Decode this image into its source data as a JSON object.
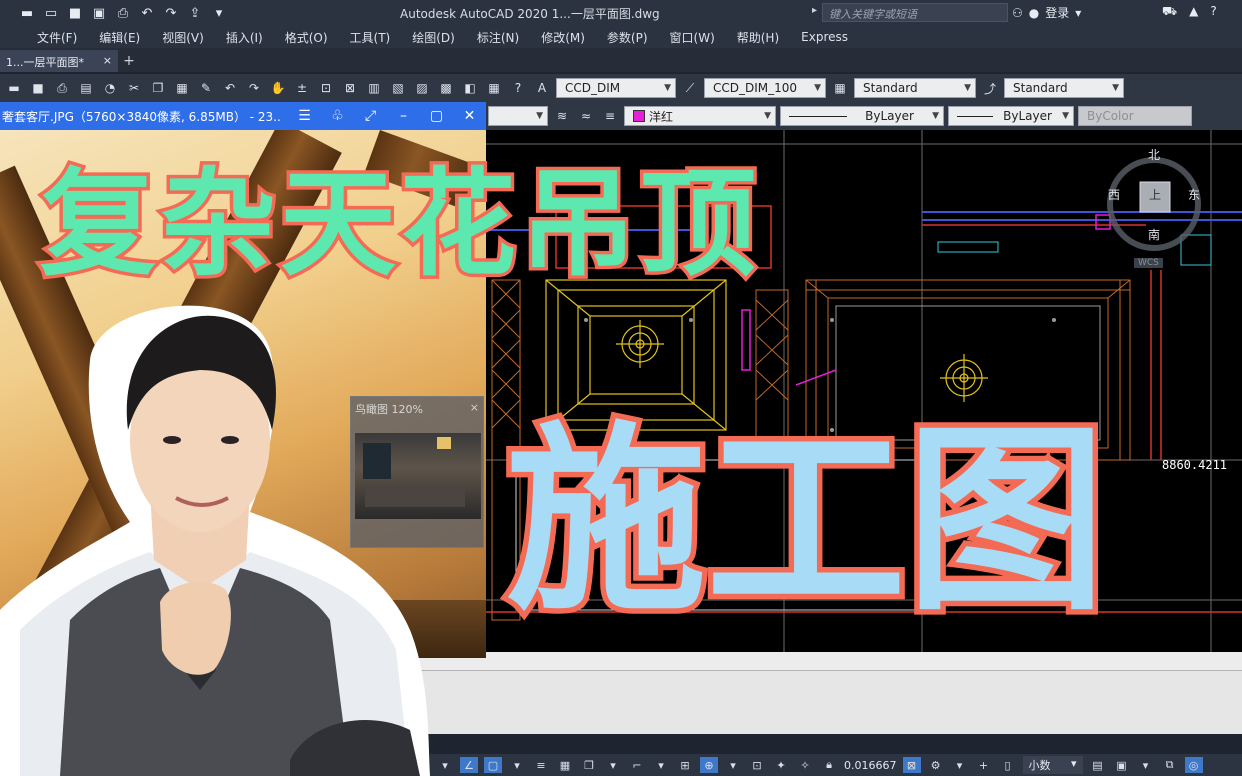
{
  "titlebar": {
    "app_title": "Autodesk AutoCAD 2020    1...一层平面图.dwg",
    "search_placeholder": "键入关键字或短语",
    "login_label": "登录",
    "icons": [
      "new-icon",
      "open-icon",
      "save-icon",
      "saveas-icon",
      "print-icon",
      "undo-icon",
      "redo-icon",
      "share-icon"
    ]
  },
  "menu": {
    "items": [
      "文件(F)",
      "编辑(E)",
      "视图(V)",
      "插入(I)",
      "格式(O)",
      "工具(T)",
      "绘图(D)",
      "标注(N)",
      "修改(M)",
      "参数(P)",
      "窗口(W)",
      "帮助(H)",
      "Express"
    ]
  },
  "tabs": {
    "file_tab": "1...一层平面图*",
    "close": "×",
    "plus": "+"
  },
  "toolbar1": {
    "text_style": "CCD_DIM",
    "dim_style": "CCD_DIM_100",
    "table_style": "Standard",
    "multileader_style": "Standard"
  },
  "toolbar2": {
    "layer_color_name": "洋红",
    "layer_color": "#e61ed8",
    "linetype": "ByLayer",
    "lineweight": "ByLayer",
    "plot_style": "ByColor"
  },
  "viewer": {
    "title": "奢套客厅.JPG（5760×3840像素, 6.85MB） - 23...",
    "navigator_title": "鸟瞰图 120%",
    "navigator_close": "×"
  },
  "viewcube": {
    "north": "北",
    "south": "南",
    "east": "东",
    "west": "西",
    "top": "上",
    "wcs": "WCS"
  },
  "canvas": {
    "coord_readout": "8860.4211"
  },
  "statusbar": {
    "scale": "0.016667",
    "units": "小数"
  },
  "overlay": {
    "headline": "复杂天花吊顶",
    "subline": "施工图"
  },
  "colors": {
    "headline_fill": "#5de8b0",
    "subline_fill": "#a8dcf6",
    "outline": "#f46b55",
    "viewer_title_bar": "#2e6ee8",
    "cad_yellow": "#e3c21a"
  }
}
